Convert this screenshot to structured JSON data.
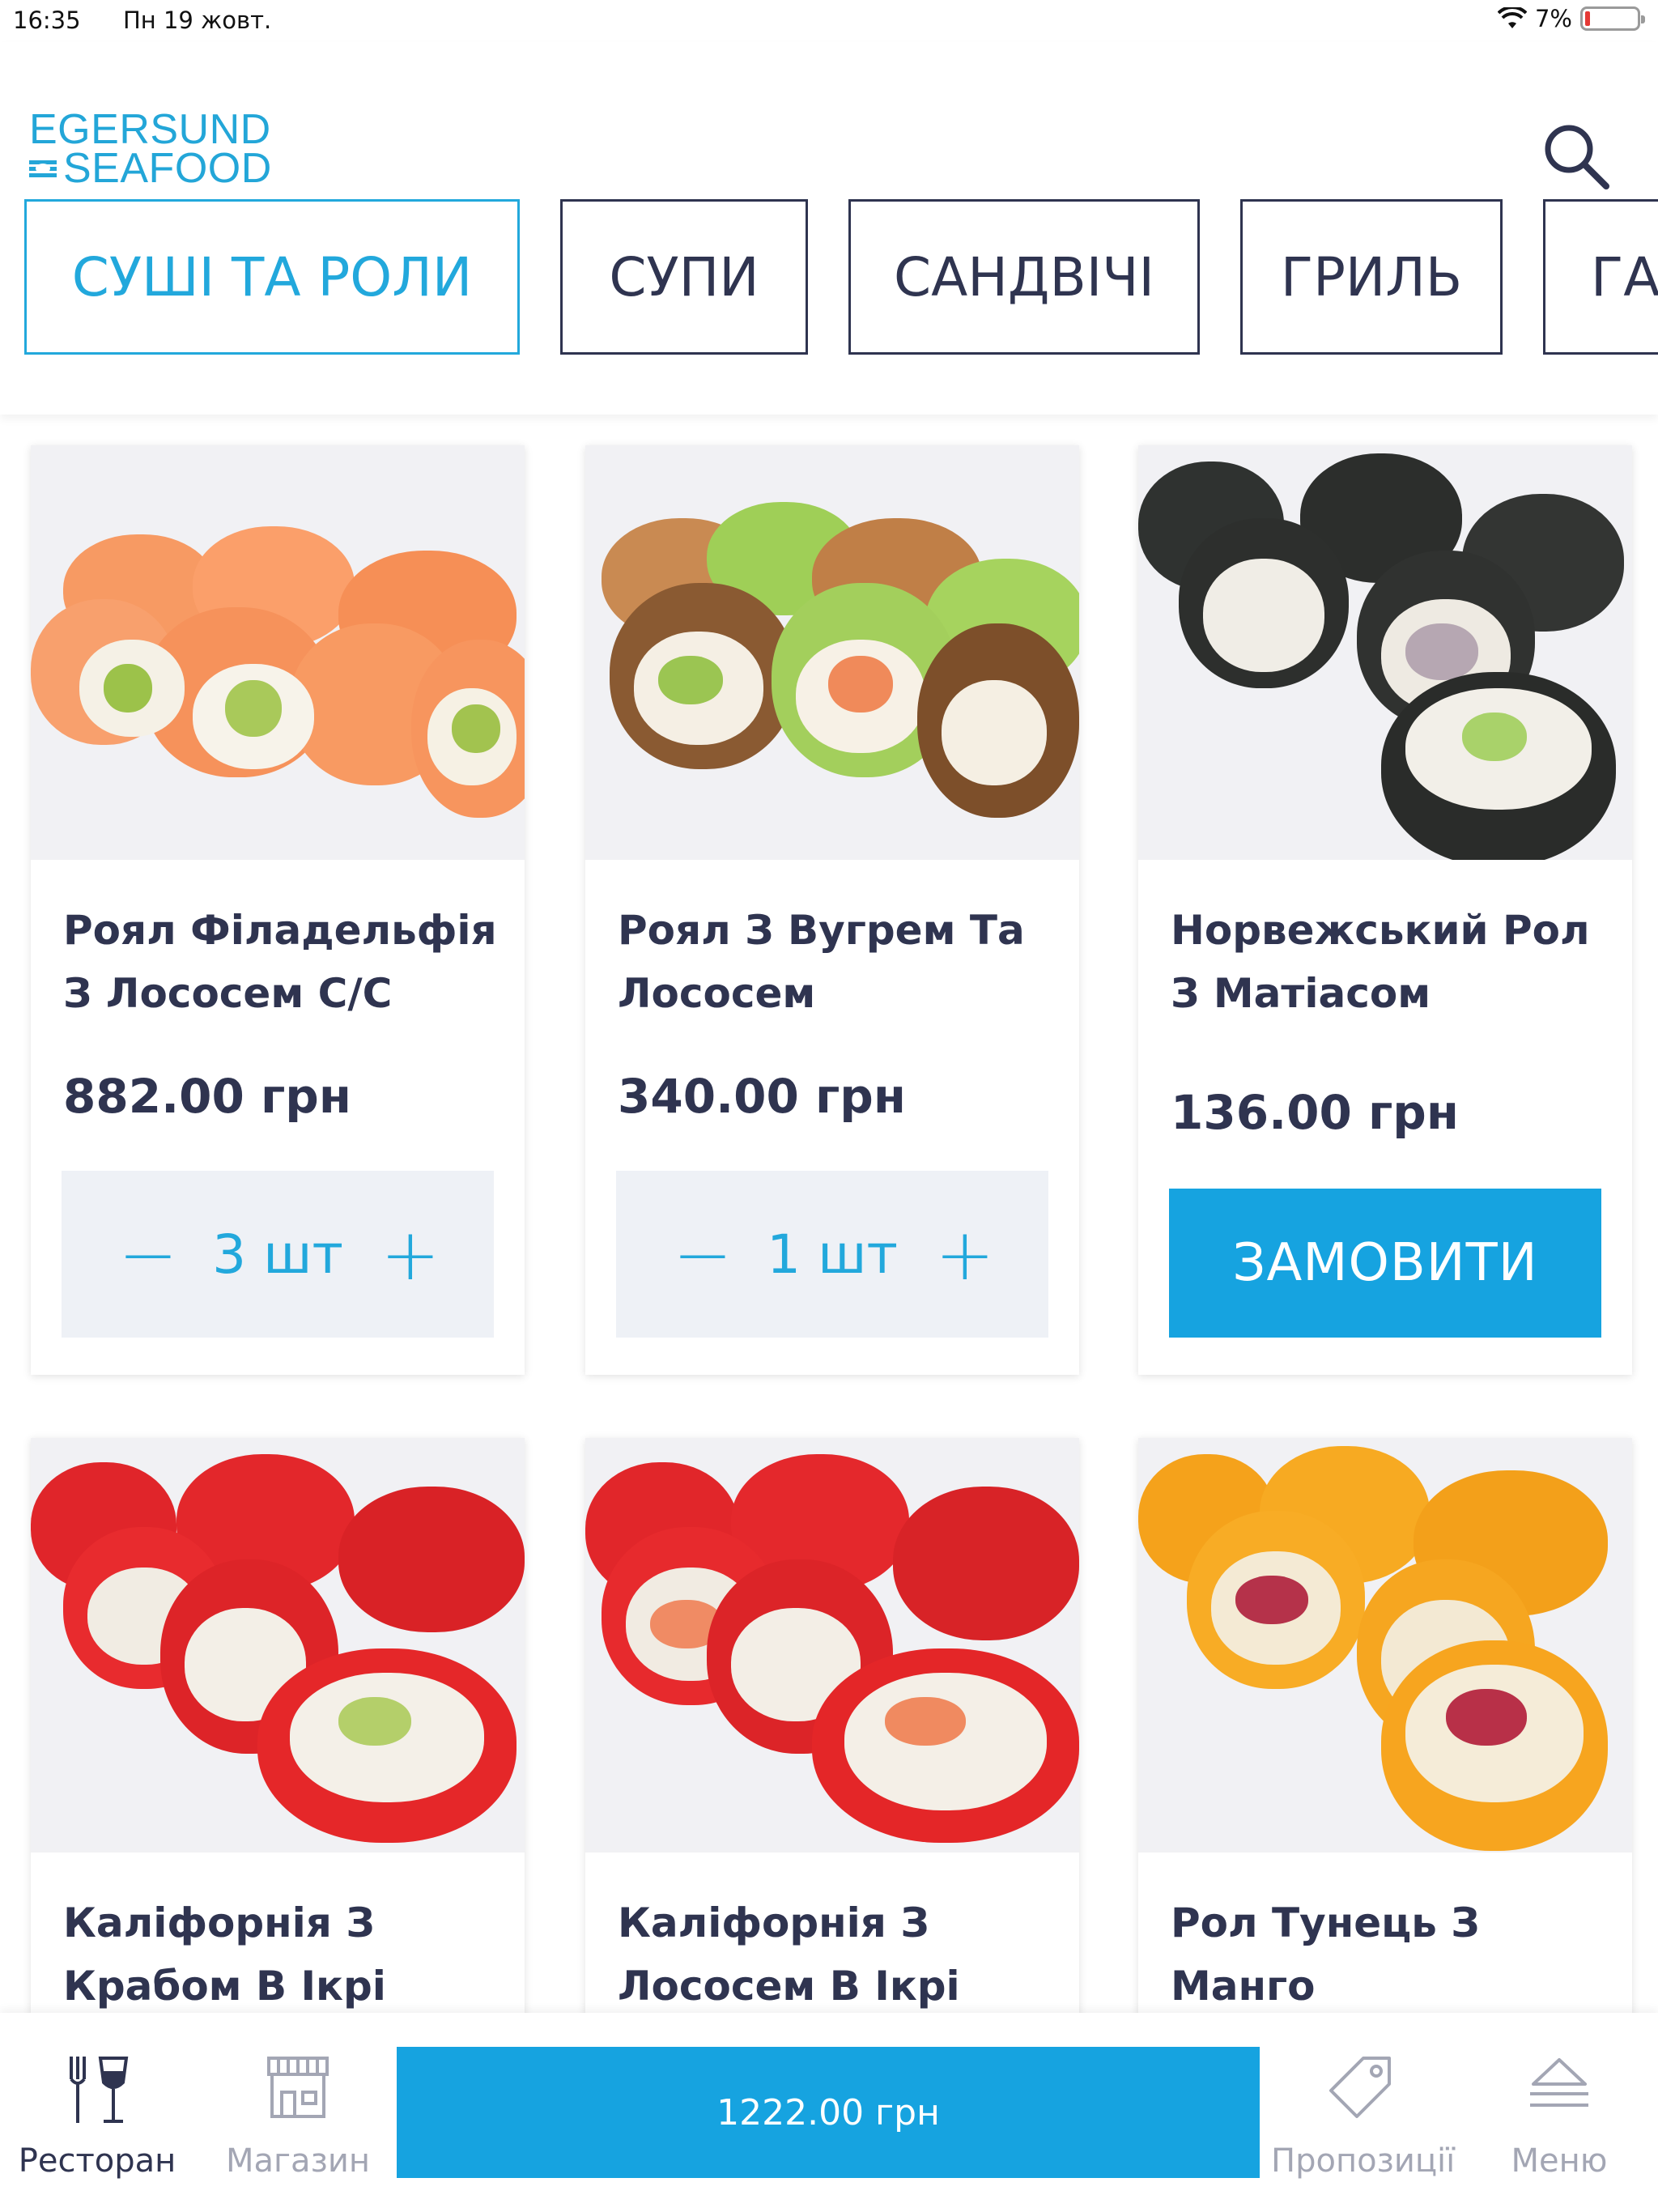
{
  "status": {
    "time": "16:35",
    "date": "Пн 19 жовт.",
    "battery": "7%"
  },
  "brand": {
    "line1": "EGERSUND",
    "line2": "SEAFOOD",
    "color": "#23a6d8"
  },
  "tabs": [
    {
      "label": "СУШІ ТА РОЛИ",
      "active": true
    },
    {
      "label": "СУПИ"
    },
    {
      "label": "САНДВІЧІ"
    },
    {
      "label": "ГРИЛЬ"
    },
    {
      "label": "ГАР"
    }
  ],
  "products": [
    {
      "name": "Роял Філадельфія З Лососем С/С",
      "price": "882.00 грн",
      "qty": "3 шт"
    },
    {
      "name": "Роял З Вугрем Та Лососем",
      "price": "340.00 грн",
      "qty": "1 шт"
    },
    {
      "name": "Норвежський Рол З Матіасом",
      "price": "136.00 грн",
      "order_label": "ЗАМОВИТИ"
    },
    {
      "name": "Каліфорнія З Крабом В Ікрі"
    },
    {
      "name": "Каліфорнія З Лососем В Ікрі"
    },
    {
      "name": "Рол Тунець З Манго"
    }
  ],
  "stepper": {
    "minus": "−",
    "plus": "+"
  },
  "bottom_nav": {
    "restaurant": "Ресторан",
    "shop": "Магазин",
    "cart_total": "1222.00 грн",
    "offers": "Пропозиції",
    "menu": "Меню"
  },
  "colors": {
    "accent": "#16a3e0",
    "text": "#2f3450",
    "muted": "#a3a6b4"
  }
}
